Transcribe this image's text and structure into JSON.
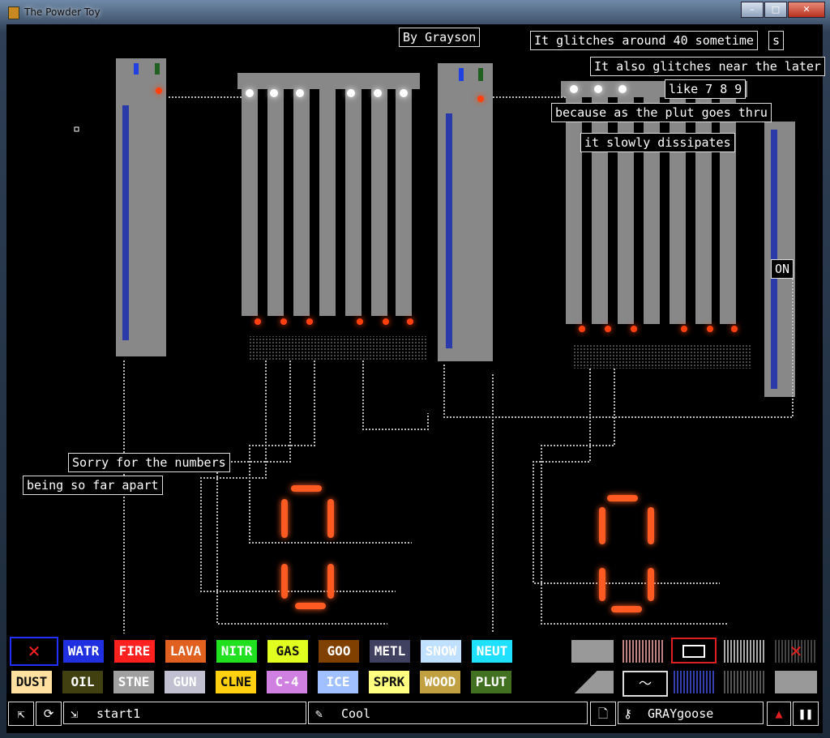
{
  "window": {
    "title": "The Powder Toy",
    "minimize": "–",
    "maximize": "□",
    "close": "✕"
  },
  "notes": {
    "by": "By Grayson",
    "n1": "It glitches around 40 sometime",
    "n1s": "s",
    "n2": "It also glitches near the later",
    "n3": "like 7 8 9",
    "n4": "because as the plut goes thru",
    "n5": "it slowly dissipates",
    "on": "ON",
    "sorry": "Sorry for the numbers",
    "apart": "being so far apart"
  },
  "palette": {
    "row1": [
      "WATR",
      "FIRE",
      "LAVA",
      "NITR",
      "GAS",
      "GOO",
      "METL",
      "SNOW",
      "NEUT"
    ],
    "row2": [
      "DUST",
      "OIL",
      "STNE",
      "GUN",
      "CLNE",
      "C-4",
      "ICE",
      "SPRK",
      "WOOD",
      "PLUT"
    ],
    "colors": {
      "WATR": "#2030e0",
      "FIRE": "#ff2020",
      "LAVA": "#e06020",
      "NITR": "#20e020",
      "GAS": "#e0ff20",
      "GOO": "#804000",
      "METL": "#404060",
      "SNOW": "#c0e0ff",
      "NEUT": "#20e0ff",
      "DUST": "#ffe0a0",
      "OIL": "#404010",
      "STNE": "#a0a0a0",
      "GUN": "#c0c0d0",
      "CLNE": "#ffd010",
      "C-4": "#d080e0",
      "ICE": "#a0c0ff",
      "SPRK": "#ffff80",
      "WOOD": "#c0a040",
      "PLUT": "#407020"
    },
    "clear_icon": "clear-x-icon"
  },
  "tools": {
    "labels": [
      "wall-gray",
      "wall-pink",
      "sign-tool",
      "wall-dots",
      "wall-erase-x",
      "wall-ramp",
      "wall-wave",
      "wall-blue",
      "wall-dark",
      "wall-solid"
    ]
  },
  "bottom": {
    "save_name": "start1",
    "tag": "Cool",
    "user": "GRAYgoose",
    "icons": [
      "open-icon",
      "reload-icon",
      "save-icon",
      "tag-icon",
      "new-icon",
      "user-icon",
      "settings-icon",
      "fire-mode-icon",
      "pause-icon"
    ]
  }
}
